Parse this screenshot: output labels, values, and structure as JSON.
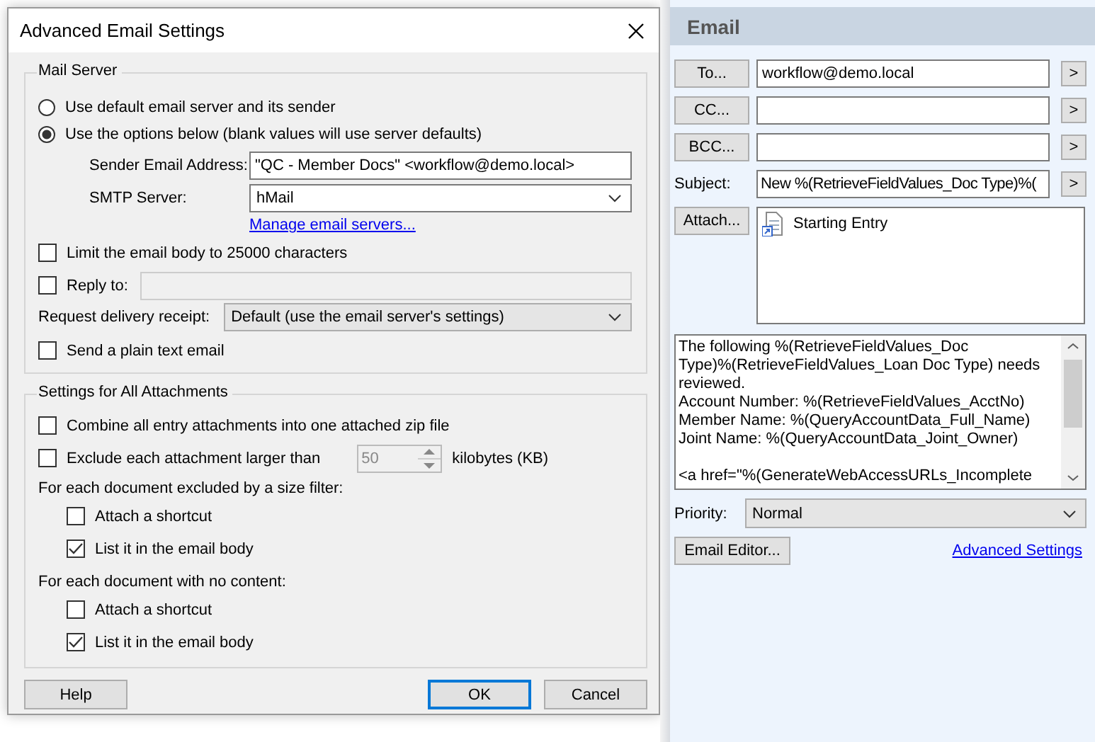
{
  "dialog": {
    "title": "Advanced Email Settings",
    "mail_server": {
      "title": "Mail Server",
      "options": [
        {
          "label": "Use default email server and its sender",
          "selected": false
        },
        {
          "label": "Use the options below (blank values will use server defaults)",
          "selected": true
        }
      ],
      "sender_label": "Sender Email Address:",
      "sender_value": "\"QC - Member Docs\" <workflow@demo.local>",
      "smtp_label": "SMTP Server:",
      "smtp_value": "hMail",
      "manage_link": "Manage email servers..."
    },
    "limit_body": {
      "label": "Limit the email body to 25000 characters",
      "checked": false
    },
    "reply_to": {
      "label": "Reply to:",
      "checked": false
    },
    "receipt": {
      "label": "Request delivery receipt:",
      "value": "Default (use the email server's settings)"
    },
    "plain_text": {
      "label": "Send a plain text email",
      "checked": false
    },
    "attachments": {
      "title": "Settings for All Attachments",
      "combine": {
        "label": "Combine all entry attachments into one attached zip file",
        "checked": false
      },
      "exclude": {
        "label": "Exclude each attachment larger than",
        "checked": false,
        "value": "50",
        "unit": "kilobytes (KB)"
      },
      "groups": [
        {
          "heading": "For each document excluded by a size filter:",
          "options": [
            {
              "label": "Attach a shortcut",
              "checked": false
            },
            {
              "label": "List it in the email body",
              "checked": true
            }
          ]
        },
        {
          "heading": "For each document with no content:",
          "options": [
            {
              "label": "Attach a shortcut",
              "checked": false
            },
            {
              "label": "List it in the email body",
              "checked": true
            }
          ]
        }
      ]
    },
    "buttons": [
      {
        "label": "Help",
        "default": false
      },
      {
        "label": "OK",
        "default": true
      },
      {
        "label": "Cancel",
        "default": false
      }
    ]
  },
  "panel": {
    "title": "Email",
    "recipients": [
      {
        "button": "To...",
        "value": "workflow@demo.local",
        "arrow": ">"
      },
      {
        "button": "CC...",
        "arrow": ">"
      },
      {
        "button": "BCC...",
        "arrow": ">"
      }
    ],
    "subject_label": "Subject:",
    "subject_value": "New %(RetrieveFieldValues_Doc Type)%(",
    "subject_arrow": ">",
    "attach_button": "Attach...",
    "attachments": [
      "Starting Entry"
    ],
    "body_paragraphs": [
      [
        "The following %(RetrieveFieldValues_Doc",
        "Type)%(RetrieveFieldValues_Loan Doc Type) needs",
        "reviewed.",
        "Account Number: %(RetrieveFieldValues_AcctNo)",
        "Member Name: %(QueryAccountData_Full_Name)",
        "Joint Name: %(QueryAccountData_Joint_Owner)"
      ],
      [
        "<a href=\"%(GenerateWebAccessURLs_Incomplete"
      ]
    ],
    "priority_label": "Priority:",
    "priority_value": "Normal",
    "editor_button": "Email Editor...",
    "advanced_link": "Advanced Settings"
  }
}
